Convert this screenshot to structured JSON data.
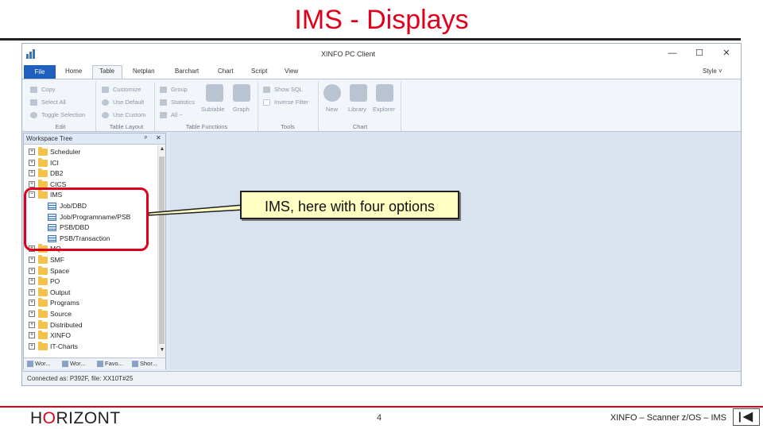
{
  "slide": {
    "title": "IMS - Displays",
    "callout": "IMS, here with four options",
    "footer": {
      "logo": [
        "H",
        "O",
        "RIZONT"
      ],
      "page_number": "4",
      "right_text": "XINFO – Scanner z/OS – IMS"
    }
  },
  "window": {
    "title": "XINFO PC Client",
    "controls": {
      "minimize": "—",
      "maximize": "☐",
      "close": "✕"
    }
  },
  "menu": {
    "file": "File",
    "items": [
      "Home",
      "Table",
      "Netplan",
      "Barchart",
      "Chart",
      "Script",
      "View"
    ],
    "active": "Table",
    "style": "Style ˅"
  },
  "ribbon": {
    "edit": {
      "label": "Edit",
      "items": [
        "Copy",
        "Select All",
        "Toggle Selection"
      ]
    },
    "table_layout": {
      "label": "Table Layout",
      "items": [
        "Customize",
        "Use Default",
        "Use Custom"
      ]
    },
    "table_functions": {
      "label": "Table Functions",
      "items": [
        "Group",
        "Statistics",
        "All ~"
      ],
      "big": [
        "Subtable",
        "Graph"
      ]
    },
    "tools": {
      "label": "Tools",
      "items": [
        "Show SQL",
        "Inverse Filter"
      ]
    },
    "chart": {
      "label": "Chart",
      "big": [
        "New",
        "Library",
        "Explorer"
      ]
    }
  },
  "workspace": {
    "title": "Workspace Tree",
    "pin": "ᵖ",
    "close": "✕",
    "tree": [
      {
        "label": "Scheduler",
        "type": "folder",
        "level": 0,
        "expander": "+"
      },
      {
        "label": "ICI",
        "type": "folder",
        "level": 0,
        "expander": "+"
      },
      {
        "label": "DB2",
        "type": "folder",
        "level": 0,
        "expander": "+"
      },
      {
        "label": "CICS",
        "type": "folder",
        "level": 0,
        "expander": "+"
      },
      {
        "label": "IMS",
        "type": "folder",
        "level": 0,
        "expander": "−"
      },
      {
        "label": "Job/DBD",
        "type": "table",
        "level": 1
      },
      {
        "label": "Job/Programname/PSB",
        "type": "table",
        "level": 1
      },
      {
        "label": "PSB/DBD",
        "type": "table",
        "level": 1
      },
      {
        "label": "PSB/Transaction",
        "type": "table",
        "level": 1
      },
      {
        "label": "MQ",
        "type": "folder",
        "level": 0,
        "expander": "+"
      },
      {
        "label": "SMF",
        "type": "folder",
        "level": 0,
        "expander": "+"
      },
      {
        "label": "Space",
        "type": "folder",
        "level": 0,
        "expander": "+"
      },
      {
        "label": "PO",
        "type": "folder",
        "level": 0,
        "expander": "+"
      },
      {
        "label": "Output",
        "type": "folder",
        "level": 0,
        "expander": "+"
      },
      {
        "label": "Programs",
        "type": "folder",
        "level": 0,
        "expander": "+"
      },
      {
        "label": "Source",
        "type": "folder",
        "level": 0,
        "expander": "+"
      },
      {
        "label": "Distributed",
        "type": "folder",
        "level": 0,
        "expander": "+"
      },
      {
        "label": "XINFO",
        "type": "folder",
        "level": 0,
        "expander": "+"
      },
      {
        "label": "IT-Charts",
        "type": "folder",
        "level": 0,
        "expander": "+"
      }
    ],
    "tabs": [
      "Wor...",
      "Wor...",
      "Favo...",
      "Shor..."
    ]
  },
  "status": {
    "text": "Connected as: P392F, file: XX10T#25"
  }
}
